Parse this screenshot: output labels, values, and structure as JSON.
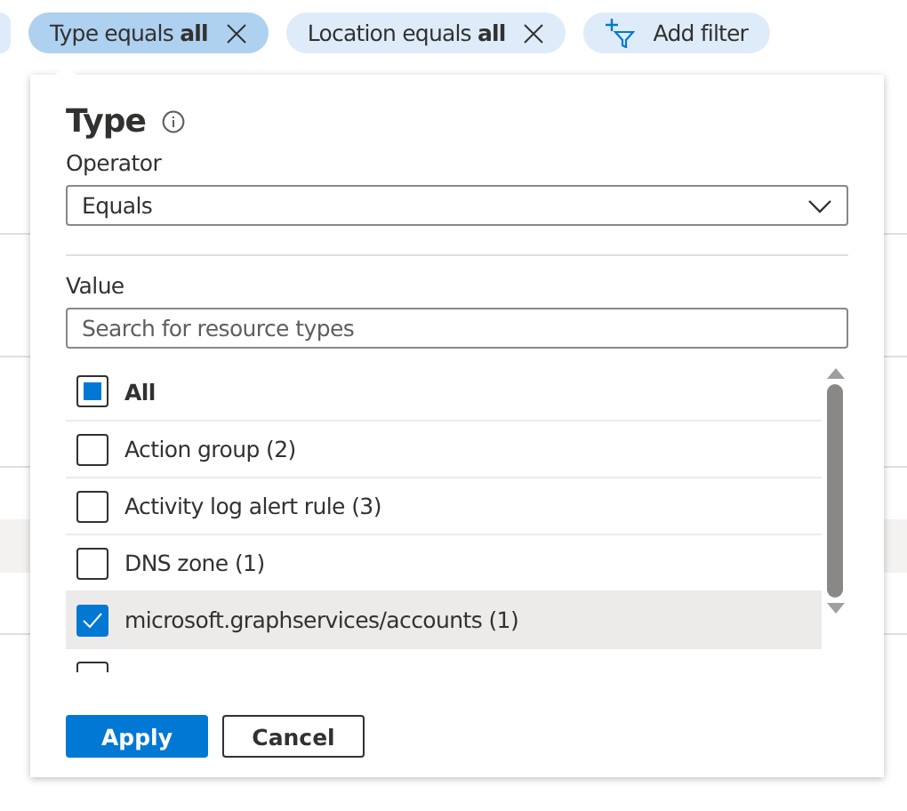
{
  "filters": [
    {
      "label": "Type equals **all**",
      "selected": true,
      "kind": "filter"
    },
    {
      "label": "Location equals **all**",
      "selected": false,
      "kind": "filter"
    },
    {
      "label": "Add filter",
      "selected": false,
      "kind": "add"
    }
  ],
  "popup": {
    "title": "Type",
    "operator_label": "Operator",
    "operator_value": "Equals",
    "value_label": "Value",
    "search": {
      "placeholder": "Search for resource types"
    },
    "options": [
      {
        "label": "All",
        "checked": false,
        "indeterminate": true,
        "hovered": false
      },
      {
        "label": "Action group (2)",
        "checked": false,
        "indeterminate": false,
        "hovered": false
      },
      {
        "label": "Activity log alert rule (3)",
        "checked": false,
        "indeterminate": false,
        "hovered": false
      },
      {
        "label": "DNS zone (1)",
        "checked": false,
        "indeterminate": false,
        "hovered": false
      },
      {
        "label": "microsoft.graphservices/accounts (1)",
        "checked": true,
        "indeterminate": false,
        "hovered": true
      },
      {
        "checked": false,
        "indeterminate": false,
        "hovered": false
      }
    ],
    "buttons": [
      {
        "label": "Apply",
        "kind": "primary"
      },
      {
        "label": "Cancel",
        "kind": "secondary"
      }
    ]
  }
}
